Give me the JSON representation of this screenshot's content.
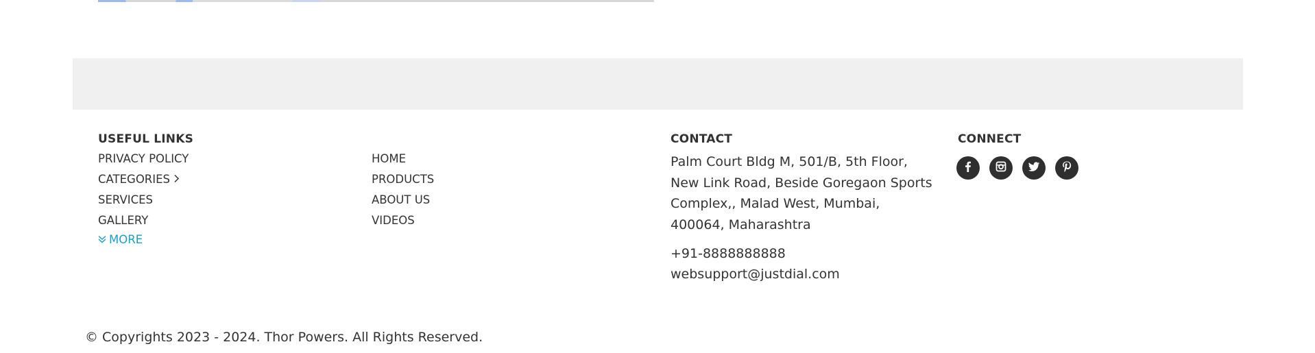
{
  "footer": {
    "useful_links": {
      "heading": "USEFUL LINKS",
      "col1": [
        {
          "label": "PRIVACY POLICY",
          "has_chevron": false
        },
        {
          "label": "CATEGORIES",
          "has_chevron": true
        },
        {
          "label": "SERVICES",
          "has_chevron": false
        },
        {
          "label": "GALLERY",
          "has_chevron": false
        }
      ],
      "col2": [
        {
          "label": "HOME"
        },
        {
          "label": "PRODUCTS"
        },
        {
          "label": "ABOUT US"
        },
        {
          "label": "VIDEOS"
        }
      ],
      "more_label": "MORE"
    },
    "contact": {
      "heading": "CONTACT",
      "address": "Palm Court Bldg M, 501/B, 5th Floor, New Link Road, Beside Goregaon Sports Complex,, Malad West, Mumbai, 400064, Maharashtra",
      "phone": "+91-8888888888",
      "email": "websupport@justdial.com"
    },
    "connect": {
      "heading": "CONNECT",
      "icons": [
        "facebook-icon",
        "instagram-icon",
        "twitter-icon",
        "pinterest-icon"
      ]
    },
    "copyright": "© Copyrights 2023 - 2024. Thor Powers. All Rights Reserved."
  },
  "colors": {
    "text": "#333333",
    "accent": "#1a9fc9",
    "band": "#f0f0f0",
    "social_bg": "#2f2f2f"
  }
}
